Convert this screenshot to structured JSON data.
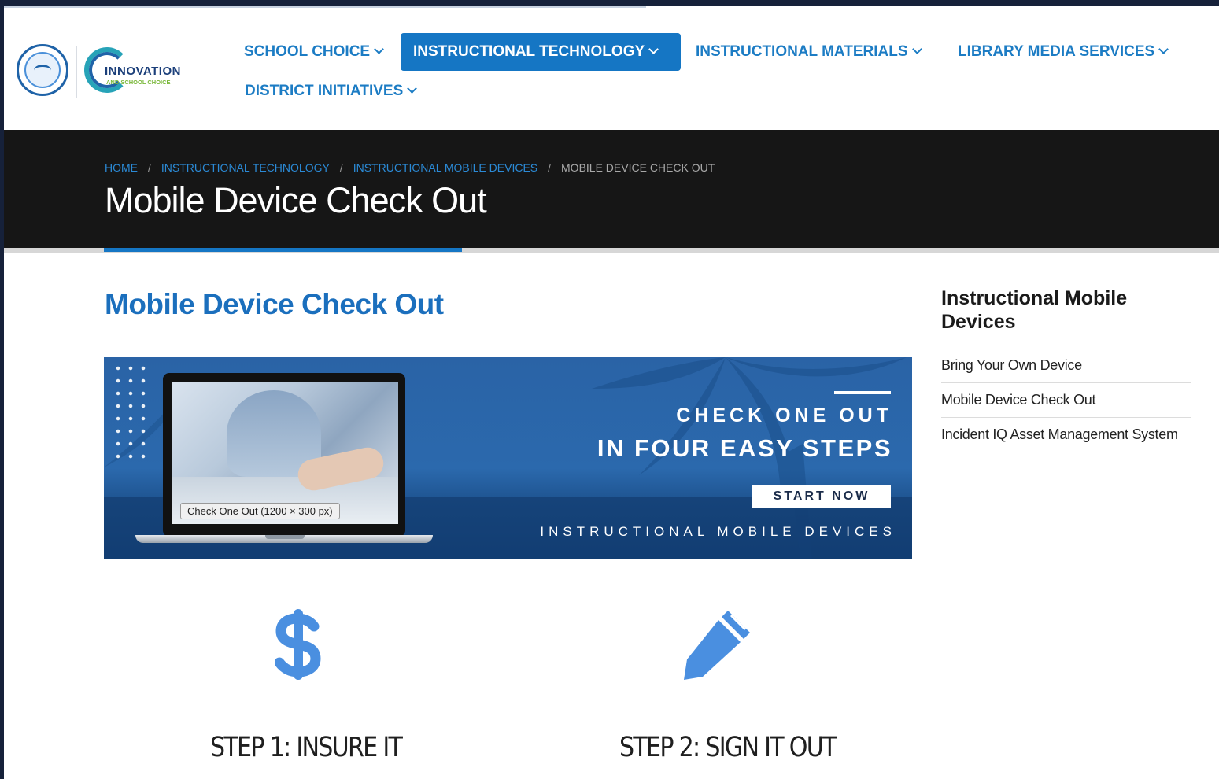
{
  "nav": {
    "items": [
      {
        "label": "SCHOOL CHOICE"
      },
      {
        "label": "INSTRUCTIONAL TECHNOLOGY"
      },
      {
        "label": "INSTRUCTIONAL MATERIALS"
      },
      {
        "label": "LIBRARY MEDIA SERVICES"
      },
      {
        "label": "DISTRICT INITIATIVES"
      }
    ],
    "active_index": 1
  },
  "logos": {
    "innovation_title": "INNOVATION",
    "innovation_sub": "AND SCHOOL CHOICE"
  },
  "breadcrumb": {
    "home": "HOME",
    "separator": "/",
    "level1": "INSTRUCTIONAL TECHNOLOGY",
    "level2": "INSTRUCTIONAL MOBILE DEVICES",
    "current": "MOBILE DEVICE CHECK OUT"
  },
  "hero": {
    "title": "Mobile Device Check Out"
  },
  "main": {
    "title": "Mobile Device Check Out",
    "banner": {
      "alt_caption": "Check One Out (1200 × 300 px)",
      "line1": "CHECK ONE OUT",
      "line2": "IN FOUR EASY STEPS",
      "button": "START NOW",
      "footer": "INSTRUCTIONAL MOBILE DEVICES"
    },
    "steps": [
      {
        "title": "STEP 1: INSURE IT",
        "icon": "dollar-icon"
      },
      {
        "title": "STEP 2: SIGN IT OUT",
        "icon": "pencil-icon"
      }
    ]
  },
  "sidebar": {
    "title": "Instructional Mobile Devices",
    "links": [
      "Bring Your Own Device",
      "Mobile Device Check Out",
      "Incident IQ Asset Management System"
    ]
  },
  "colors": {
    "brand_blue": "#1576c4",
    "link_blue": "#1c7cc4",
    "hero_bg": "#161616",
    "icon_blue": "#4a8fe0"
  }
}
